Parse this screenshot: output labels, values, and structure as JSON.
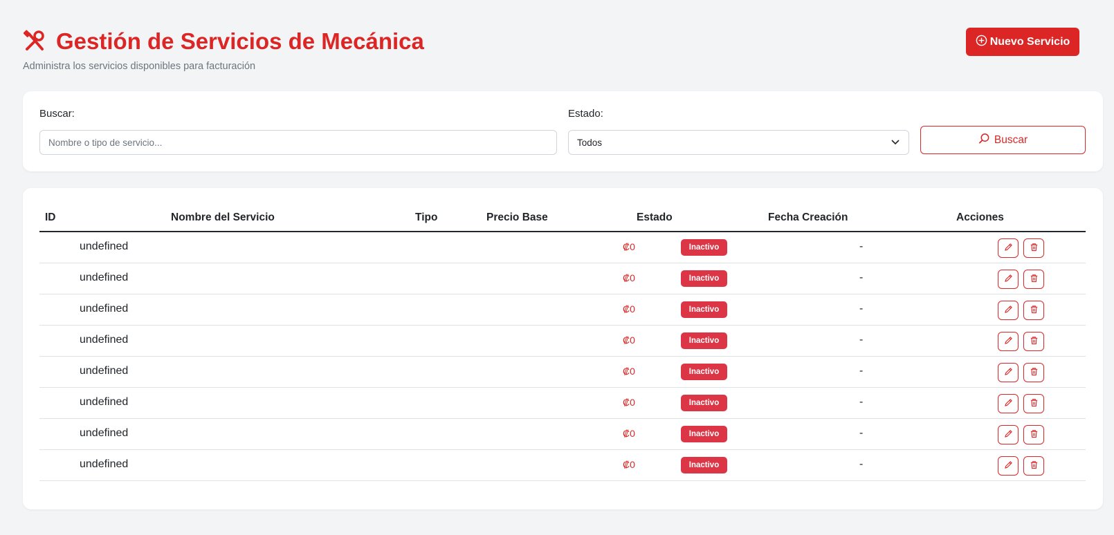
{
  "header": {
    "title": "Gestión de Servicios de Mecánica",
    "subtitle": "Administra los servicios disponibles para facturación",
    "icon": "tools-icon",
    "new_button_label": "Nuevo Servicio",
    "new_button_icon": "plus-circle-icon"
  },
  "filters": {
    "search_label": "Buscar:",
    "search_placeholder": "Nombre o tipo de servicio...",
    "search_value": "",
    "status_label": "Estado:",
    "status_selected": "Todos",
    "search_button_label": "Buscar",
    "search_button_icon": "search-icon"
  },
  "table": {
    "columns": [
      "ID",
      "Nombre del Servicio",
      "Tipo",
      "Precio Base",
      "Estado",
      "Fecha Creación",
      "Acciones"
    ],
    "rows": [
      {
        "id": "",
        "name": "undefined",
        "type": "",
        "price": "₡0",
        "status": "Inactivo",
        "date": "-"
      },
      {
        "id": "",
        "name": "undefined",
        "type": "",
        "price": "₡0",
        "status": "Inactivo",
        "date": "-"
      },
      {
        "id": "",
        "name": "undefined",
        "type": "",
        "price": "₡0",
        "status": "Inactivo",
        "date": "-"
      },
      {
        "id": "",
        "name": "undefined",
        "type": "",
        "price": "₡0",
        "status": "Inactivo",
        "date": "-"
      },
      {
        "id": "",
        "name": "undefined",
        "type": "",
        "price": "₡0",
        "status": "Inactivo",
        "date": "-"
      },
      {
        "id": "",
        "name": "undefined",
        "type": "",
        "price": "₡0",
        "status": "Inactivo",
        "date": "-"
      },
      {
        "id": "",
        "name": "undefined",
        "type": "",
        "price": "₡0",
        "status": "Inactivo",
        "date": "-"
      },
      {
        "id": "",
        "name": "undefined",
        "type": "",
        "price": "₡0",
        "status": "Inactivo",
        "date": "-"
      }
    ],
    "action_icons": [
      "pencil-icon",
      "trash-icon"
    ]
  },
  "colors": {
    "accent": "#dc2626",
    "badge_inactive": "#dc3545",
    "background": "#f3f4f6",
    "card": "#ffffff"
  }
}
